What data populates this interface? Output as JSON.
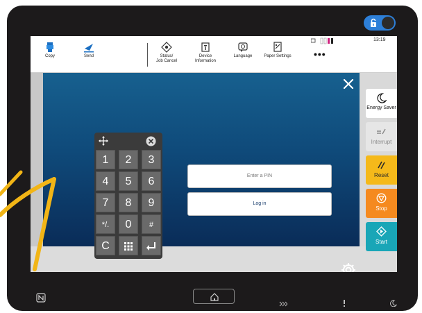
{
  "status_bar": {
    "time": "13:19"
  },
  "menu": {
    "items": [
      {
        "label": "Copy",
        "icon": "copy-icon"
      },
      {
        "label": "Send",
        "icon": "send-icon"
      },
      {
        "label_line1": "Status/",
        "label_line2": "Job Cancel",
        "icon": "status-icon"
      },
      {
        "label_line1": "Device",
        "label_line2": "Information",
        "icon": "device-info-icon"
      },
      {
        "label": "Language",
        "icon": "language-icon"
      },
      {
        "label": "Paper Settings",
        "icon": "paper-settings-icon"
      }
    ],
    "more": "•••"
  },
  "login": {
    "pin_placeholder": "Enter a PIN",
    "login_label": "Log in"
  },
  "keypad": {
    "keys": [
      "1",
      "2",
      "3",
      "4",
      "5",
      "6",
      "7",
      "8",
      "9",
      "*/.",
      "0",
      "#",
      "C",
      "",
      ""
    ]
  },
  "side_buttons": {
    "energy_saver": "Energy Saver",
    "interrupt": "Interrupt",
    "reset": "Reset",
    "stop": "Stop",
    "start": "Start"
  },
  "colors": {
    "panel_top": "#17608f",
    "panel_bottom": "#0a2c58",
    "reset": "#f5b91a",
    "stop": "#f58a1f",
    "start": "#19a6b7",
    "lock_toggle": "#2d7fd8",
    "arrow": "#f2b516"
  }
}
